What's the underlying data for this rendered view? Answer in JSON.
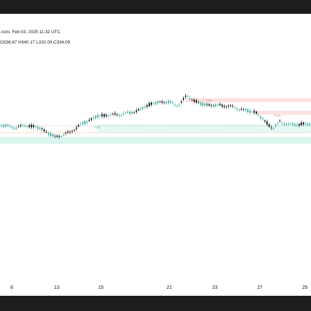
{
  "header": {
    "attribution_snippet": ".com, Feb 03, 2025 11:32 UTC",
    "ohlc": "O336.67  H340.17  L332.00  C334.09"
  },
  "colors": {
    "up": "#26a69a",
    "down": "#ef5350",
    "candle": "#000000",
    "fvg_bear_fill": "#fde2e2",
    "fvg_bull_fill": "#d9f5ee",
    "fvg_text_bear": "#e57373",
    "fvg_text_bull": "#4db6ac"
  },
  "chart_data": {
    "type": "candlestick",
    "x_axis": {
      "ticks": [
        "8",
        "13",
        "15",
        "21",
        "23",
        "27",
        "29"
      ]
    },
    "annotations": [
      "FVG",
      "FVG",
      "FVG"
    ],
    "indicators": {
      "fvg_bear_count": 2,
      "fvg_bull_count": 1
    }
  }
}
